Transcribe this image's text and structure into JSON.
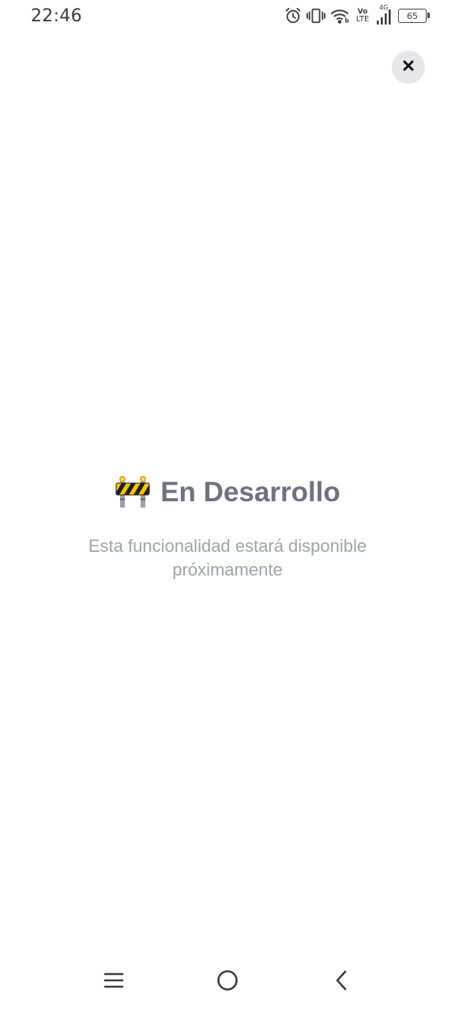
{
  "status_bar": {
    "time": "22:46",
    "network_vo": "Vo",
    "network_lte": "LTE",
    "network_gen": "4G",
    "battery_level": "65",
    "icons": [
      "alarm-icon",
      "vibrate-icon",
      "wifi-icon",
      "signal-icon",
      "battery-icon"
    ]
  },
  "dialog": {
    "close_icon": "close-icon",
    "title_emoji_icon": "construction-barrier-icon",
    "title": "En Desarrollo",
    "message": "Esta funcionalidad estará disponible próximamente"
  },
  "nav_bar": {
    "icons": [
      "menu-icon",
      "home-icon",
      "back-icon"
    ]
  },
  "colors": {
    "title": "#6b7280",
    "message": "#9ca3af",
    "close_bg": "#e5e7eb",
    "barrier_yellow": "#f5c211",
    "barrier_black": "#1f1f1f"
  }
}
